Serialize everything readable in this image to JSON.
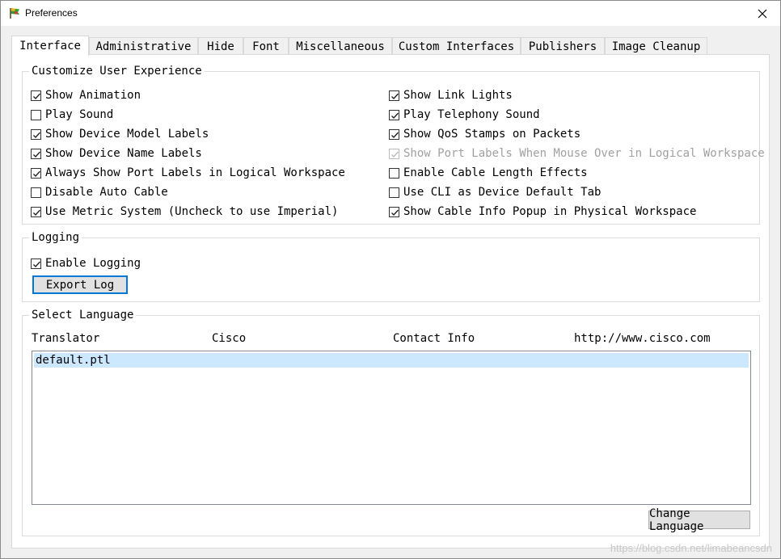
{
  "window": {
    "title": "Preferences",
    "app_icon": "packet-tracer-flag-icon",
    "close_icon": "close-icon"
  },
  "tabs": [
    {
      "label": "Interface",
      "active": true
    },
    {
      "label": "Administrative"
    },
    {
      "label": "Hide"
    },
    {
      "label": "Font"
    },
    {
      "label": "Miscellaneous"
    },
    {
      "label": "Custom Interfaces"
    },
    {
      "label": "Publishers"
    },
    {
      "label": "Image Cleanup"
    }
  ],
  "customize": {
    "title": "Customize User Experience",
    "left": [
      {
        "label": "Show Animation",
        "checked": true
      },
      {
        "label": "Play Sound",
        "checked": false
      },
      {
        "label": "Show Device Model Labels",
        "checked": true
      },
      {
        "label": "Show Device Name Labels",
        "checked": true
      },
      {
        "label": "Always Show Port Labels in Logical Workspace",
        "checked": true
      },
      {
        "label": "Disable Auto Cable",
        "checked": false
      },
      {
        "label": "Use Metric System (Uncheck to use Imperial)",
        "checked": true
      }
    ],
    "right": [
      {
        "label": "Show Link Lights",
        "checked": true
      },
      {
        "label": "Play Telephony Sound",
        "checked": true
      },
      {
        "label": "Show QoS Stamps on Packets",
        "checked": true
      },
      {
        "label": "Show Port Labels When Mouse Over in Logical Workspace",
        "checked": true,
        "disabled": true
      },
      {
        "label": "Enable Cable Length Effects",
        "checked": false
      },
      {
        "label": "Use CLI as Device Default Tab",
        "checked": false
      },
      {
        "label": "Show Cable Info Popup in Physical Workspace",
        "checked": true
      }
    ]
  },
  "logging": {
    "title": "Logging",
    "enable_label": "Enable Logging",
    "enable_checked": true,
    "export_label": "Export Log"
  },
  "language": {
    "title": "Select Language",
    "columns": [
      "Translator",
      "Cisco",
      "Contact Info",
      "http://www.cisco.com"
    ],
    "items": [
      {
        "label": "default.ptl",
        "selected": true
      }
    ],
    "change_label": "Change Language"
  },
  "watermark": "https://blog.csdn.net/limabeancsdn"
}
